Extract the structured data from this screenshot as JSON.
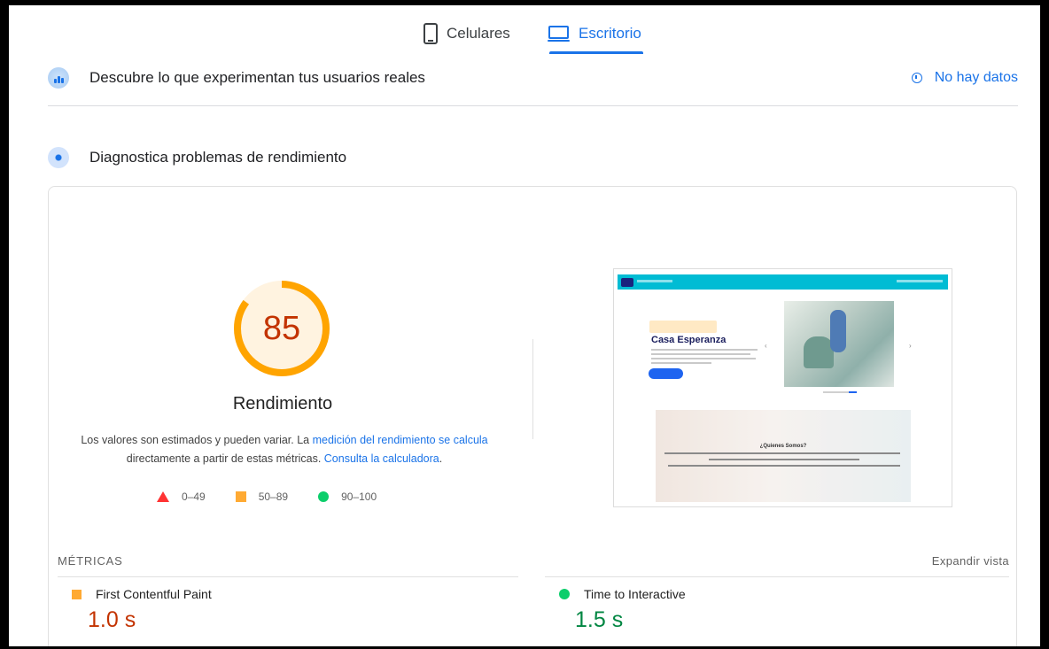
{
  "tabs": [
    {
      "label": "Celulares",
      "icon": "phone-icon",
      "active": false
    },
    {
      "label": "Escritorio",
      "icon": "laptop-icon",
      "active": true
    }
  ],
  "field_section": {
    "title": "Descubre lo que experimentan tus usuarios reales",
    "icon": "crux-icon",
    "status_label": "No hay datos",
    "status_icon": "info-icon"
  },
  "lab_section": {
    "title": "Diagnostica problemas de rendimiento",
    "icon": "lab-icon"
  },
  "gauge": {
    "score": "85",
    "score_fraction": 0.85,
    "label": "Rendimiento",
    "color": "#ffa400",
    "track_color": "#fff3e0",
    "text_color": "#c33300"
  },
  "description": {
    "text1": "Los valores son estimados y pueden variar. La ",
    "link1": "medición del rendimiento se calcula",
    "text2": " directamente a partir de estas métricas. ",
    "link2": "Consulta la calculadora",
    "text3": "."
  },
  "legend": [
    {
      "range": "0–49",
      "shape": "triangle",
      "color": "#ff3333"
    },
    {
      "range": "50–89",
      "shape": "square",
      "color": "#ffaa33"
    },
    {
      "range": "90–100",
      "shape": "circle",
      "color": "#0cce6b"
    }
  ],
  "screenshot": {
    "hero_title": "Casa Esperanza",
    "section_title": "¿Quienes Somos?"
  },
  "metrics": {
    "title": "MÉTRICAS",
    "expand_label": "Expandir vista",
    "items": [
      {
        "name": "First Contentful Paint",
        "value": "1.0 s",
        "color": "#c33300",
        "indicator": "square"
      },
      {
        "name": "Time to Interactive",
        "value": "1.5 s",
        "color": "#018642",
        "indicator": "circle"
      }
    ]
  }
}
